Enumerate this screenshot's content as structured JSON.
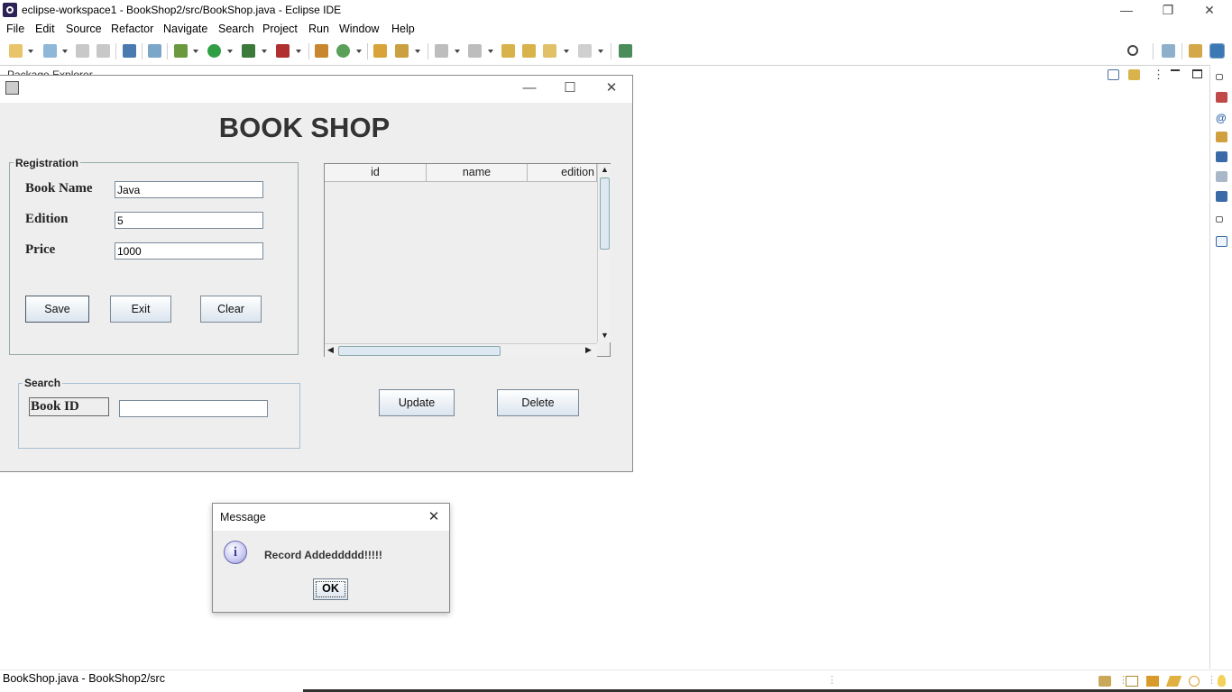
{
  "window": {
    "title": "eclipse-workspace1 - BookShop2/src/BookShop.java - Eclipse IDE",
    "minimize": "—",
    "restore": "❐",
    "close": "✕"
  },
  "menu": [
    "File",
    "Edit",
    "Source",
    "Refactor",
    "Navigate",
    "Search",
    "Project",
    "Run",
    "Window",
    "Help"
  ],
  "view_tab": {
    "label": "Package Explorer"
  },
  "status_bar": {
    "text": "BookShop.java - BookShop2/src"
  },
  "app": {
    "title": "BOOK SHOP",
    "registration": {
      "legend": "Registration",
      "book_name_label": "Book Name",
      "book_name_value": "Java",
      "edition_label": "Edition",
      "edition_value": "5",
      "price_label": "Price",
      "price_value": "1000",
      "save": "Save",
      "exit": "Exit",
      "clear": "Clear"
    },
    "table": {
      "columns": [
        "id",
        "name",
        "edition"
      ]
    },
    "update": "Update",
    "delete": "Delete",
    "search": {
      "legend": "Search",
      "book_id_label": "Book ID",
      "book_id_value": ""
    }
  },
  "dialog": {
    "title": "Message",
    "message": "Record Addeddddd!!!!!",
    "ok": "OK",
    "info_icon_glyph": "i",
    "close_glyph": "✕"
  },
  "icons": {
    "info": "info-icon",
    "search": "search-icon"
  }
}
